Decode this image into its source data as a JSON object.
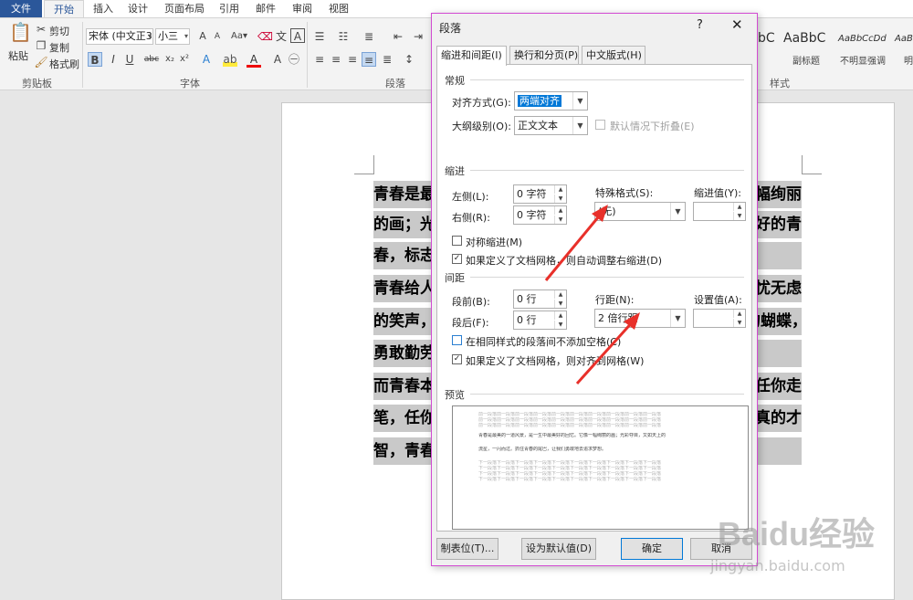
{
  "ribbon": {
    "tabs": [
      "文件",
      "开始",
      "插入",
      "设计",
      "页面布局",
      "引用",
      "邮件",
      "审阅",
      "视图"
    ],
    "clipboard": {
      "paste": "粘贴",
      "cut": "剪切",
      "copy": "复制",
      "format_painter": "格式刷",
      "group": "剪贴板"
    },
    "font": {
      "name": "宋体 (中文正3",
      "size": "小三",
      "group": "字体"
    },
    "paragraph_group": "段落",
    "styles": {
      "samples": [
        "bC",
        "AaBbC",
        "AaBbCcDd",
        "AaBb"
      ],
      "names": [
        "副标题",
        "不明显强调",
        "明"
      ],
      "group": "样式"
    }
  },
  "document": {
    "lines_left": [
      "青春是最",
      "的画；光",
      "春，标志",
      "青春给人",
      "的笑声，",
      "勇敢勤劳",
      "而青春本",
      "笔，任你",
      "智，青春"
    ],
    "lines_right": [
      "幅绚丽",
      "好的青",
      "",
      "忧无虑",
      "的蝴蝶，",
      "",
      "任你走",
      "真的才",
      ""
    ]
  },
  "dialog": {
    "title": "段落",
    "help": "?",
    "close": "✕",
    "tabs": [
      "缩进和间距(I)",
      "换行和分页(P)",
      "中文版式(H)"
    ],
    "general": {
      "section": "常规",
      "alignment_label": "对齐方式(G):",
      "alignment_value": "两端对齐",
      "outline_label": "大纲级别(O):",
      "outline_value": "正文文本",
      "collapse_label": "默认情况下折叠(E)"
    },
    "indent": {
      "section": "缩进",
      "left_label": "左侧(L):",
      "left_value": "0 字符",
      "right_label": "右侧(R):",
      "right_value": "0 字符",
      "special_label": "特殊格式(S):",
      "special_value": "(无)",
      "by_label": "缩进值(Y):",
      "mirror_label": "对称缩进(M)",
      "auto_adjust_label": "如果定义了文档网格，则自动调整右缩进(D)"
    },
    "spacing": {
      "section": "间距",
      "before_label": "段前(B):",
      "before_value": "0 行",
      "after_label": "段后(F):",
      "after_value": "0 行",
      "line_label": "行距(N):",
      "line_value": "2 倍行距",
      "at_label": "设置值(A):",
      "no_space_label": "在相同样式的段落间不添加空格(C)",
      "snap_grid_label": "如果定义了文档网格，则对齐到网格(W)"
    },
    "preview": {
      "section": "预览",
      "prev_text": "前一段落前一段落前一段落前一段落前一段落前一段落前一段落前一段落前一段落前一段落",
      "sample_text": "青春是最美的一道风景，是一生中最美好的回忆。它像一幅绚丽的画；光彩夺目，又如天上的",
      "sample_text2": "流星，一闪而过。抓住青春的尾巴，让我们勇敢地去追求梦想。",
      "next_text": "下一段落下一段落下一段落下一段落下一段落下一段落下一段落下一段落下一段落下一段落"
    },
    "buttons": {
      "tabs": "制表位(T)...",
      "default": "设为默认值(D)",
      "ok": "确定",
      "cancel": "取消"
    }
  },
  "watermark": {
    "text": "Baidu经验",
    "url": "jingyan.baidu.com"
  },
  "colors": {
    "accent": "#2b579a",
    "arrow": "#e8302a",
    "dialog_border": "#d24ad2",
    "selection": "#0078d7"
  }
}
